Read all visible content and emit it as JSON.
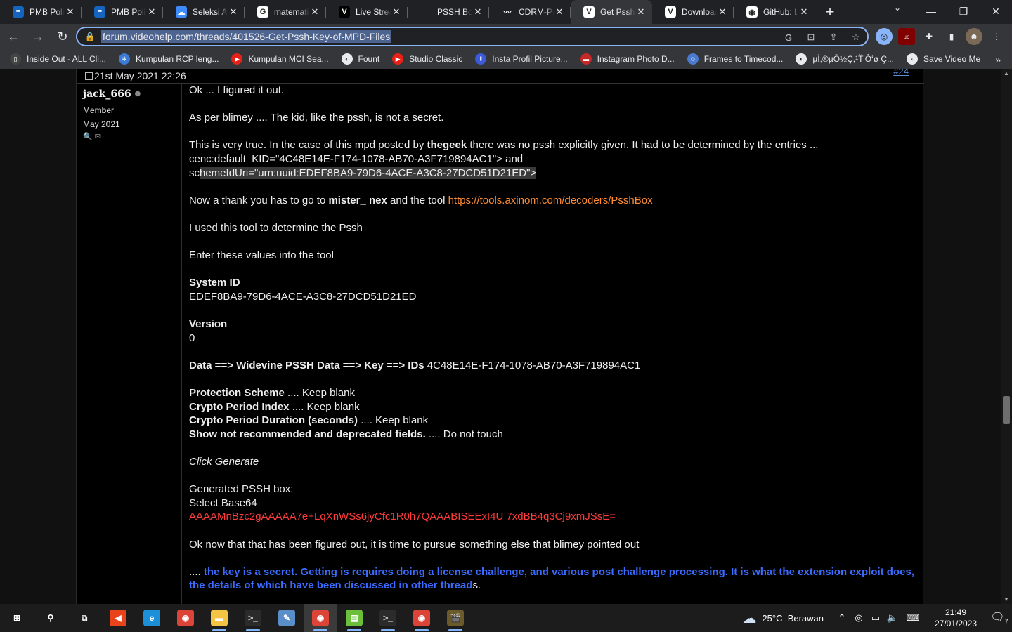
{
  "browser": {
    "tabs": [
      {
        "title": "PMB Politeknik",
        "favicon": "pmb-icon",
        "color": "#1565c0",
        "glyph": "≡"
      },
      {
        "title": "PMB Politeknik",
        "favicon": "pmb-icon",
        "color": "#1565c0",
        "glyph": "≡"
      },
      {
        "title": "Seleksi Admin",
        "favicon": "cloud-icon",
        "color": "#3d8bfd",
        "glyph": "☁"
      },
      {
        "title": "matematika",
        "favicon": "google-icon",
        "color": "#ffffff",
        "glyph": "G"
      },
      {
        "title": "Live Stream",
        "favicon": "v-logo-icon",
        "color": "#000000",
        "glyph": "V"
      },
      {
        "title": "PSSH Box",
        "favicon": "blank-icon",
        "color": "#202124",
        "glyph": ""
      },
      {
        "title": "CDRM-Project",
        "favicon": "wave-icon",
        "color": "#202124",
        "glyph": "〰"
      },
      {
        "title": "Get Pssh Key",
        "favicon": "videohelp-icon",
        "color": "#ffffff",
        "glyph": "V"
      },
      {
        "title": "Download",
        "favicon": "videohelp-icon",
        "color": "#ffffff",
        "glyph": "V"
      },
      {
        "title": "GitHub: Let's",
        "favicon": "github-icon",
        "color": "#ffffff",
        "glyph": "◉"
      }
    ],
    "active_tab": 7,
    "close_glyph": "✕",
    "new_tab_glyph": "+",
    "tab_search_glyph": "⌄",
    "window_controls": {
      "minimize": "—",
      "restore": "❐",
      "close": "✕"
    },
    "nav": {
      "back": "←",
      "forward": "→",
      "reload": "↻"
    },
    "url": "forum.videohelp.com/threads/401526-Get-Pssh-Key-of-MPD-Files",
    "bookmarks": [
      {
        "label": "Inside Out - ALL Cli...",
        "icon": "page-icon",
        "color": "#444",
        "glyph": "▯"
      },
      {
        "label": "Kumpulan RCP leng...",
        "icon": "gear-icon",
        "color": "#3a7bd5",
        "glyph": "✻"
      },
      {
        "label": "Kumpulan MCI Sea...",
        "icon": "youtube-icon",
        "color": "#e62117",
        "glyph": "▶"
      },
      {
        "label": "Fount",
        "icon": "chrome-icon",
        "color": "#e8eaed",
        "glyph": "◐"
      },
      {
        "label": "Studio Classic",
        "icon": "youtube-icon",
        "color": "#e62117",
        "glyph": "▶"
      },
      {
        "label": "Insta Profil Picture...",
        "icon": "download-icon",
        "color": "#3b5bdb",
        "glyph": "⬇"
      },
      {
        "label": "Instagram Photo D...",
        "icon": "flag-icon",
        "color": "#c62828",
        "glyph": "▬"
      },
      {
        "label": "Frames to Timecod...",
        "icon": "people-icon",
        "color": "#4a7bd0",
        "glyph": "☺"
      },
      {
        "label": "µÎ,®µÕ½Ç,¹Ť'Ôʻø Ç...",
        "icon": "chrome-icon",
        "color": "#e8eaed",
        "glyph": "◐"
      },
      {
        "label": "Save Video Me",
        "icon": "chrome-icon",
        "color": "#e8eaed",
        "glyph": "◐"
      }
    ],
    "bookmarks_more": "»"
  },
  "post": {
    "date": "21st May 2021 22:26",
    "number": "#24",
    "author": {
      "name": "jack_666",
      "status_dot": "●",
      "role": "Member",
      "joined": "May 2021"
    },
    "paragraphs": {
      "p1": "Ok ... I figured it out.",
      "p2": "As per blimey .... The kid, like the pssh, is not a secret.",
      "p3a": "This is very true. In the case of this mpd posted by ",
      "p3b": "thegeek",
      "p3c": " there was no pssh explicitly given. It had to be determined by the entries ...",
      "p3d": "cenc:default_KID=\"4C48E14E-F174-1078-AB70-A3F719894AC1\"> and",
      "p3e": "sc",
      "p3f": "hemeIdUri=\"urn:uuid:EDEF8BA9-79D6-4ACE-A3C8-27DCD51D21ED\"> ",
      "p4a": "Now a thank you has to go to ",
      "p4b": "mister_ nex",
      "p4c": " and the tool ",
      "p4link": "https://tools.axinom.com/decoders/PsshBox",
      "p5": "I used this tool to determine the Pssh",
      "p6": "Enter these values into the tool",
      "sysid_label": "System ID",
      "sysid_value": "EDEF8BA9-79D6-4ACE-A3C8-27DCD51D21ED",
      "version_label": "Version",
      "version_value": "0",
      "data_label": "Data ==> Widevine PSSH Data ==> Key ==> IDs",
      "data_value": " 4C48E14E-F174-1078-AB70-A3F719894AC1",
      "prot_label": "Protection Scheme",
      "prot_value": " .... Keep blank",
      "cpi_label": "Crypto Period Index",
      "cpi_value": " .... Keep blank",
      "cpd_label": "Crypto Period Duration (seconds)",
      "cpd_value": " .... Keep blank",
      "snr_label": "Show not recommended and deprecated fields.",
      "snr_value": " .... Do not touch",
      "click_generate": "Click Generate",
      "generated": "Generated PSSH box:",
      "select_base64": "Select Base64",
      "base64": "AAAAMnBzc2gAAAAA7e+LqXnWSs6jyCfc1R0h7QAAABISEExI4U 7xdBB4q3Cj9xmJSsE=",
      "p8": "Ok now that that has been figured out, it is time to pursue something else that blimey pointed out",
      "p9a": ".... ",
      "p9b": "the key is a secret. Getting is requires doing a license challenge, and various post challenge processing. It is what the extension exploit does, the details of which have been discussed in other thread",
      "p9c": "s."
    }
  },
  "taskbar": {
    "apps": [
      {
        "name": "start-button",
        "glyph": "⊞",
        "color": "transparent",
        "running": false
      },
      {
        "name": "search-button",
        "glyph": "⚲",
        "color": "transparent",
        "running": false
      },
      {
        "name": "task-view-button",
        "glyph": "⧉",
        "color": "transparent",
        "running": false
      },
      {
        "name": "media-app",
        "glyph": "◀",
        "color": "#e8431b",
        "running": false
      },
      {
        "name": "edge-app",
        "glyph": "e",
        "color": "#1b8fd8",
        "running": false
      },
      {
        "name": "chrome-app",
        "glyph": "◉",
        "color": "#db4437",
        "running": false
      },
      {
        "name": "file-explorer-app",
        "glyph": "▬",
        "color": "#f4c542",
        "running": true
      },
      {
        "name": "terminal-app",
        "glyph": ">_",
        "color": "#2b2b2b",
        "running": true
      },
      {
        "name": "editor-app",
        "glyph": "✎",
        "color": "#5a8ec9",
        "running": false
      },
      {
        "name": "chrome-profile-app",
        "glyph": "◉",
        "color": "#db4437",
        "running": true
      },
      {
        "name": "notepad-app",
        "glyph": "▤",
        "color": "#6bbf3a",
        "running": true
      },
      {
        "name": "terminal-app-2",
        "glyph": ">_",
        "color": "#2b2b2b",
        "running": true
      },
      {
        "name": "chrome-app-2",
        "glyph": "◉",
        "color": "#db4437",
        "running": true
      },
      {
        "name": "clapper-app",
        "glyph": "🎬",
        "color": "#6b5a2a",
        "running": true
      }
    ],
    "weather": {
      "temp": "25°C",
      "condition": "Berawan"
    },
    "time": "21:49",
    "date": "27/01/2023",
    "notifications": "7"
  }
}
